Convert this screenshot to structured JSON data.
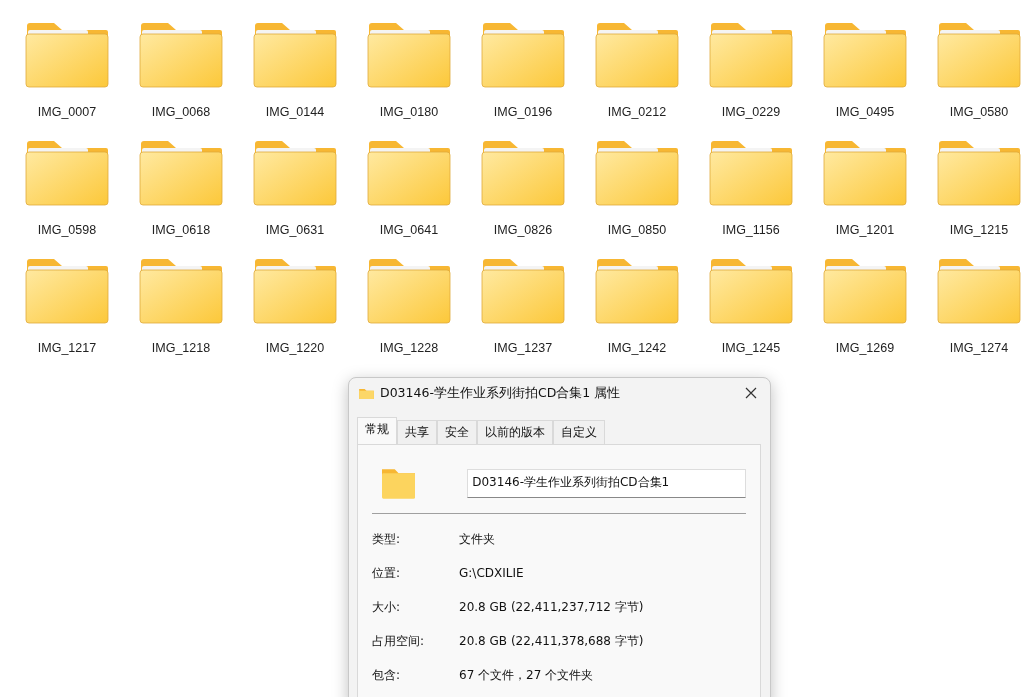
{
  "folders": [
    {
      "name": "IMG_0007"
    },
    {
      "name": "IMG_0068"
    },
    {
      "name": "IMG_0144"
    },
    {
      "name": "IMG_0180"
    },
    {
      "name": "IMG_0196"
    },
    {
      "name": "IMG_0212"
    },
    {
      "name": "IMG_0229"
    },
    {
      "name": "IMG_0495"
    },
    {
      "name": "IMG_0580"
    },
    {
      "name": "IMG_0598"
    },
    {
      "name": "IMG_0618"
    },
    {
      "name": "IMG_0631"
    },
    {
      "name": "IMG_0641"
    },
    {
      "name": "IMG_0826"
    },
    {
      "name": "IMG_0850"
    },
    {
      "name": "IMG_1156"
    },
    {
      "name": "IMG_1201"
    },
    {
      "name": "IMG_1215"
    },
    {
      "name": "IMG_1217"
    },
    {
      "name": "IMG_1218"
    },
    {
      "name": "IMG_1220"
    },
    {
      "name": "IMG_1228"
    },
    {
      "name": "IMG_1237"
    },
    {
      "name": "IMG_1242"
    },
    {
      "name": "IMG_1245"
    },
    {
      "name": "IMG_1269"
    },
    {
      "name": "IMG_1274"
    }
  ],
  "dialog": {
    "title": "D03146-学生作业系列街拍CD合集1 属性",
    "tabs": [
      {
        "label": "常规",
        "selected": true
      },
      {
        "label": "共享",
        "selected": false
      },
      {
        "label": "安全",
        "selected": false
      },
      {
        "label": "以前的版本",
        "selected": false
      },
      {
        "label": "自定义",
        "selected": false
      }
    ],
    "name_value": "D03146-学生作业系列街拍CD合集1",
    "properties": [
      {
        "label": "类型:",
        "value": "文件夹"
      },
      {
        "label": "位置:",
        "value": "G:\\CDXILIE"
      },
      {
        "label": "大小:",
        "value": "20.8 GB (22,411,237,712 字节)"
      },
      {
        "label": "占用空间:",
        "value": "20.8 GB (22,411,378,688 字节)"
      },
      {
        "label": "包含:",
        "value": "67 个文件，27 个文件夹"
      }
    ]
  }
}
